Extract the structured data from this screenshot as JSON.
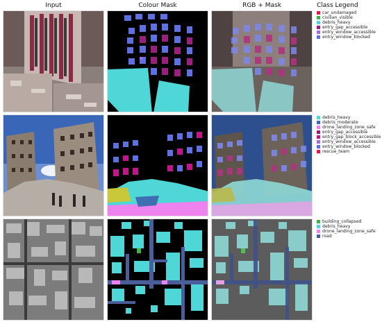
{
  "headers": {
    "input": "Input",
    "colour_mask": "Colour Mask",
    "rgb_mask": "RGB + Mask",
    "class_legend": "Class Legend"
  },
  "legends": [
    {
      "items": [
        {
          "label": "car_undamaged",
          "color": "#e6194b"
        },
        {
          "label": "civilian_visible",
          "color": "#3cb44b"
        },
        {
          "label": "debris_heavy",
          "color": "#4fd6d6"
        },
        {
          "label": "entry_gap_accessible",
          "color": "#9b1f7c"
        },
        {
          "label": "entry_window_accessible",
          "color": "#a66bd6"
        },
        {
          "label": "entry_window_blocked",
          "color": "#5f70e0"
        }
      ]
    },
    {
      "items": [
        {
          "label": "debris_heavy",
          "color": "#4fd6d6"
        },
        {
          "label": "debris_moderate",
          "color": "#3e6fb0"
        },
        {
          "label": "drone_landing_zone_safe",
          "color": "#ee82ee"
        },
        {
          "label": "entry_gap_accessible",
          "color": "#9b1f7c"
        },
        {
          "label": "entry_gap_block_accessible",
          "color": "#c0168a"
        },
        {
          "label": "entry_window_accessible",
          "color": "#a66bd6"
        },
        {
          "label": "entry_window_blocked",
          "color": "#5f70e0"
        },
        {
          "label": "rescue_team",
          "color": "#e6194b"
        }
      ]
    },
    {
      "items": [
        {
          "label": "building_collapsed",
          "color": "#3cb44b"
        },
        {
          "label": "debris_heavy",
          "color": "#4fd6d6"
        },
        {
          "label": "drone_landing_zone_safe",
          "color": "#ee82ee"
        },
        {
          "label": "road",
          "color": "#4a5f9a"
        }
      ]
    }
  ]
}
